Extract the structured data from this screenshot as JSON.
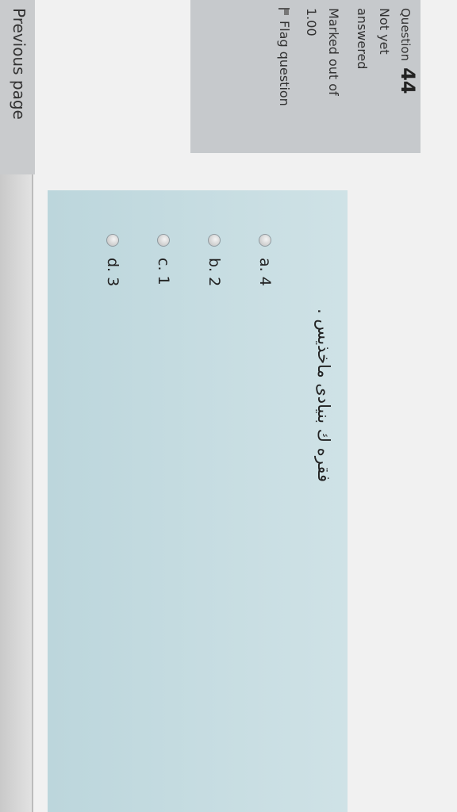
{
  "info": {
    "question_label": "Question",
    "question_number": "44",
    "state": "Not yet answered",
    "mark": "Marked out of 1.00",
    "flag": "Flag question"
  },
  "question": {
    "text": "فقره ك بنيادى ماخذيس ."
  },
  "answers": [
    {
      "label": "a. 4"
    },
    {
      "label": "b. 2"
    },
    {
      "label": "c. 1"
    },
    {
      "label": "d. 3"
    }
  ],
  "navigation": {
    "previous_page": "Previous page"
  },
  "icons": {
    "flag": "flag-icon",
    "radio": "radio-icon"
  },
  "colors": {
    "info_box": "#c6c9cc",
    "question_box": "#c5dcdf",
    "page_bg": "#f1f1f1"
  }
}
